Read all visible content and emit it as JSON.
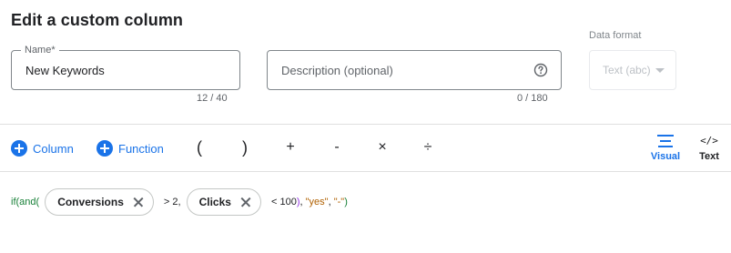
{
  "dialog": {
    "title": "Edit a custom column"
  },
  "name_field": {
    "label": "Name*",
    "value": "New Keywords",
    "counter": "12 / 40"
  },
  "description_field": {
    "placeholder": "Description (optional)",
    "counter": "0 / 180",
    "icon": "help-icon"
  },
  "data_format": {
    "label": "Data format",
    "value": "Text (abc)",
    "disabled": true
  },
  "toolbar": {
    "column_label": "Column",
    "function_label": "Function",
    "operators": [
      "(",
      ")",
      "+",
      "-",
      "×",
      "÷"
    ],
    "visual_label": "Visual",
    "text_label": "Text",
    "active_mode": "Visual"
  },
  "formula": {
    "if_and": "if(and(",
    "chip1": "Conversions",
    "after1": " > 2,",
    "chip2": "Clicks",
    "after2_op": " < 100",
    "close_paren": ")",
    "comma1": ", ",
    "str_yes": "\"yes\"",
    "comma2": ", ",
    "str_dash": "\"-\"",
    "final_paren": ")"
  },
  "colors": {
    "accent": "#1a73e8",
    "function": "#188038",
    "string": "#b06000",
    "paren": "#9334e6"
  }
}
